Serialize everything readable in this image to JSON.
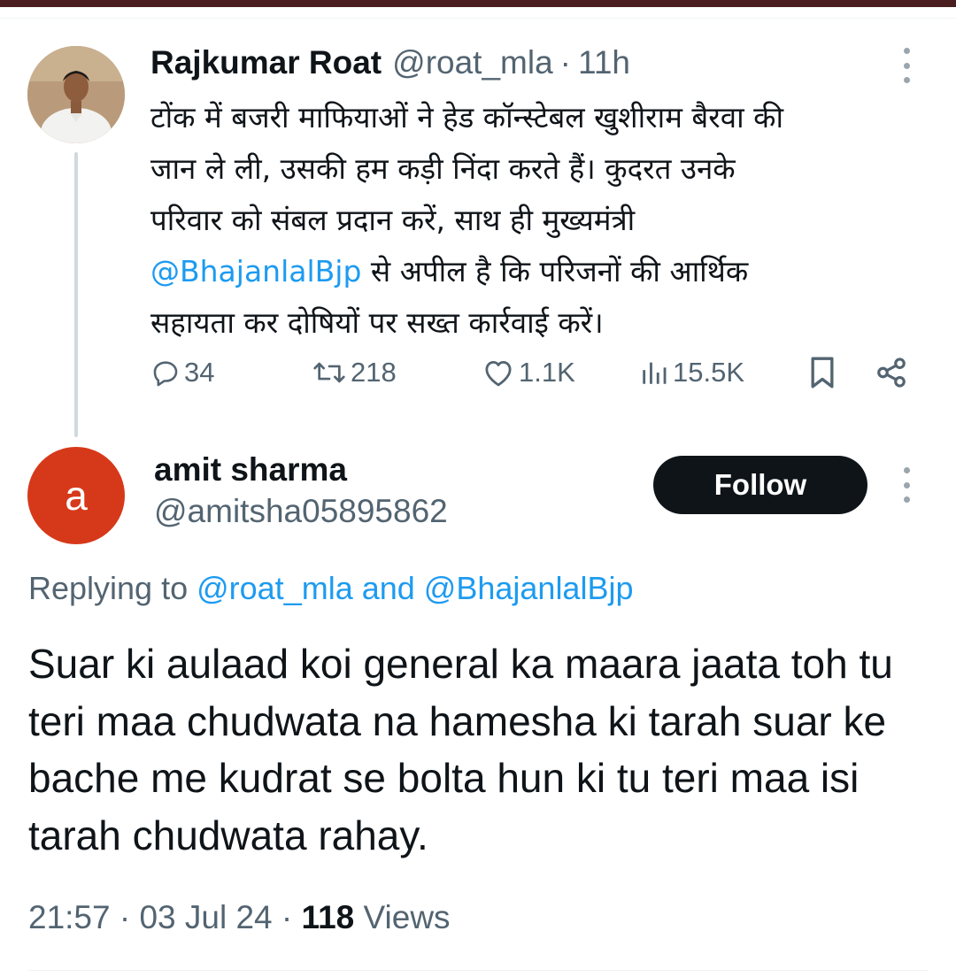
{
  "parent_tweet": {
    "author_name": "Rajkumar Roat",
    "handle": "@roat_mla",
    "separator": "·",
    "time": "11h",
    "text_before_mention": "टोंक में बजरी माफियाओं ने हेड कॉन्स्टेबल खुशीराम बैरवा की\nजान ले ली, उसकी हम कड़ी निंदा करते हैं। कुदरत उनके\nपरिवार को संबल प्रदान करें, साथ ही मुख्यमंत्री\n",
    "mention": "@BhajanlalBjp",
    "text_after_mention": " से अपील है कि परिजनों की आर्थिक\nसहायता कर दोषियों पर सख्त कार्रवाई करें।",
    "stats": {
      "replies": "34",
      "reposts": "218",
      "likes": "1.1K",
      "views": "15.5K"
    },
    "icons": [
      "reply-icon",
      "repost-icon",
      "like-icon",
      "views-icon",
      "bookmark-icon",
      "share-icon",
      "more-icon"
    ]
  },
  "reply": {
    "avatar_letter": "a",
    "avatar_color": "#d6391a",
    "author_name": "amit sharma",
    "handle": "@amitsha05895862",
    "follow_label": "Follow",
    "replying_to_prefix": "Replying to ",
    "replying_to_mention_1": "@roat_mla",
    "replying_to_and": " and ",
    "replying_to_mention_2": "@BhajanlalBjp",
    "text": "Suar ki aulaad koi general ka maara jaata toh tu teri maa chudwata na hamesha ki tarah suar ke bache me kudrat se bolta hun ki tu teri maa isi tarah chudwata rahay.",
    "timestamp": "21:57 · 03 Jul 24 · ",
    "views_count": "118",
    "views_label": " Views"
  },
  "colors": {
    "link": "#1d9bf0",
    "secondary_text": "#536471",
    "primary_text": "#0f1419",
    "follow_button_bg": "#0f1419",
    "top_bar": "#4a1e1e"
  }
}
